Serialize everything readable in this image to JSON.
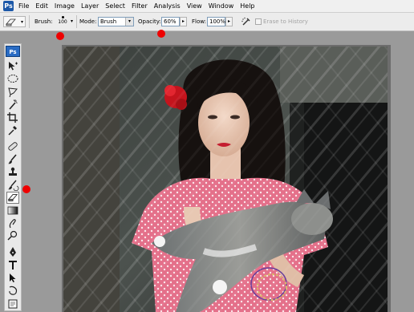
{
  "menubar": {
    "app_icon_label": "Ps",
    "items": [
      "File",
      "Edit",
      "Image",
      "Layer",
      "Select",
      "Filter",
      "Analysis",
      "View",
      "Window",
      "Help"
    ]
  },
  "options_bar": {
    "brush_label": "Brush:",
    "brush_size": "100",
    "mode_label": "Mode:",
    "mode_value": "Brush",
    "opacity_label": "Opacity:",
    "opacity_value": "60%",
    "flow_label": "Flow:",
    "flow_value": "100%",
    "erase_to_history_label": "Erase to History",
    "erase_to_history_checked": false
  },
  "toolbox": {
    "logo": "Ps",
    "active_tool": "eraser-tool",
    "tools": [
      "move-tool",
      "lasso-tool",
      "polygonal-lasso-tool",
      "magic-wand-tool",
      "crop-tool",
      "eyedropper-tool",
      "healing-brush-tool",
      "brush-tool",
      "clone-stamp-tool",
      "history-brush-tool",
      "eraser-tool",
      "gradient-tool",
      "blur-tool",
      "dodge-tool",
      "pen-tool",
      "type-tool",
      "path-selection-tool",
      "shape-tool",
      "notes-tool",
      "hand-tool"
    ]
  },
  "colors": {
    "annotation_marker": "#e00000",
    "toolbox_bg": "#e9e9e9",
    "workspace_bg": "#9a9a9a"
  }
}
